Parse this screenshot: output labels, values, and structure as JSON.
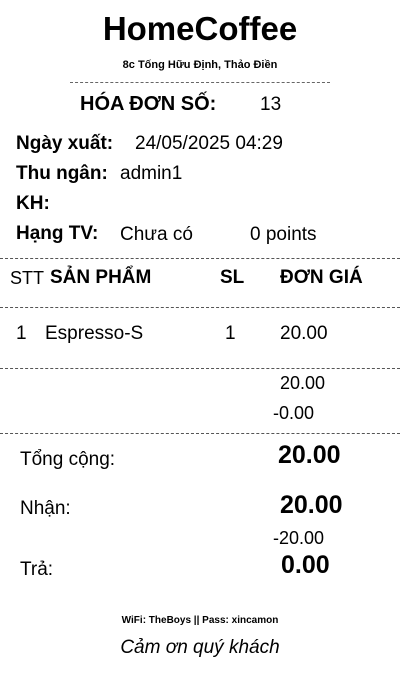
{
  "store": {
    "name": "HomeCoffee",
    "address": "8c Tống Hữu Định, Thảo Điền"
  },
  "invoice": {
    "number_label": "HÓA ĐƠN SỐ:",
    "number": "13"
  },
  "info": {
    "date_label": "Ngày xuất:",
    "date": "24/05/2025 04:29",
    "cashier_label": "Thu ngân:",
    "cashier": "admin1",
    "customer_label": "KH:",
    "customer": "",
    "tier_label": "Hạng TV:",
    "tier": "Chưa có",
    "points": "0 points"
  },
  "table": {
    "headers": {
      "stt": "STT",
      "product": "SẢN PHẨM",
      "qty": "SL",
      "price": "ĐƠN GIÁ"
    },
    "rows": [
      {
        "stt": "1",
        "product": "Espresso-S",
        "qty": "1",
        "price": "20.00"
      }
    ]
  },
  "subtotals": {
    "subtotal": "20.00",
    "discount": "-0.00"
  },
  "totals": {
    "total_label": "Tổng cộng:",
    "total": "20.00",
    "received_label": "Nhận:",
    "received": "20.00",
    "change_adjust": "-20.00",
    "change_label": "Trả:",
    "change": "0.00"
  },
  "footer": {
    "wifi": "WiFi: TheBoys || Pass: xincamon",
    "thanks": "Cảm ơn quý khách"
  }
}
